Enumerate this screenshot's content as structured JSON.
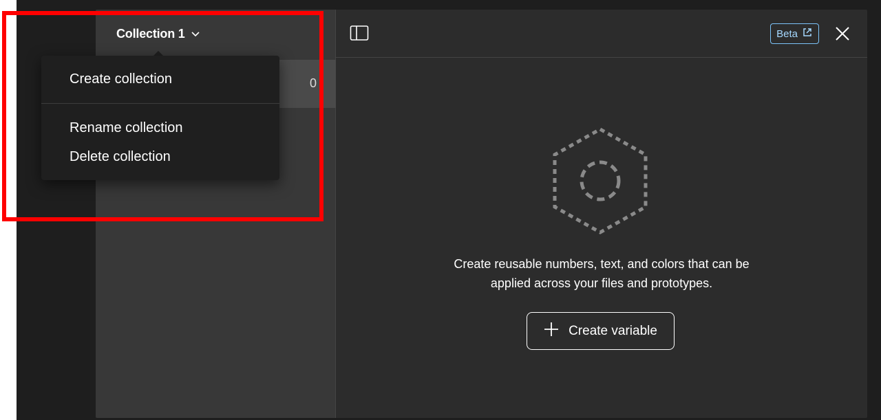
{
  "sidebar": {
    "collection_title": "Collection 1",
    "collection_count": "0"
  },
  "menu": {
    "items": [
      "Create collection",
      "Rename collection",
      "Delete collection"
    ]
  },
  "topbar": {
    "beta_label": "Beta"
  },
  "empty_state": {
    "line1": "Create reusable numbers, text, and colors that can be",
    "line2": "applied across your files and prototypes.",
    "button_label": "Create variable"
  },
  "icons": [
    "chevron-down-icon",
    "sidebar-toggle-icon",
    "external-link-icon",
    "close-icon",
    "hexagon-variable-icon",
    "plus-icon"
  ],
  "colors": {
    "highlight": "#ff0000",
    "beta_border": "#7cc4fa",
    "sidebar_bg": "#383838",
    "menu_bg": "#1f1f1f"
  }
}
